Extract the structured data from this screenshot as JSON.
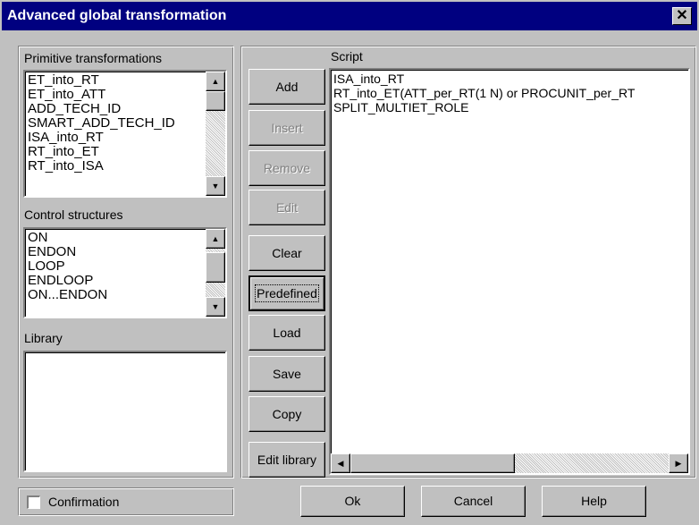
{
  "window": {
    "title": "Advanced global transformation",
    "close_glyph": "✕"
  },
  "left_panel": {
    "primitive": {
      "label": "Primitive transformations",
      "items": [
        "ET_into_RT",
        "ET_into_ATT",
        "ADD_TECH_ID",
        "SMART_ADD_TECH_ID",
        "ISA_into_RT",
        "RT_into_ET",
        "RT_into_ISA"
      ]
    },
    "control": {
      "label": "Control structures",
      "items": [
        "ON",
        "ENDON",
        "LOOP",
        "ENDLOOP",
        "ON...ENDON"
      ]
    },
    "library": {
      "label": "Library",
      "items": []
    }
  },
  "buttons": {
    "add": "Add",
    "insert": "Insert",
    "remove": "Remove",
    "edit": "Edit",
    "clear": "Clear",
    "predefined": "Predefined",
    "load": "Load",
    "save": "Save",
    "copy": "Copy",
    "edit_library": "Edit library"
  },
  "script": {
    "label": "Script",
    "lines": [
      "ISA_into_RT",
      "RT_into_ET(ATT_per_RT(1 N) or PROCUNIT_per_RT",
      "SPLIT_MULTIET_ROLE"
    ]
  },
  "footer": {
    "confirmation": "Confirmation",
    "ok": "Ok",
    "cancel": "Cancel",
    "help": "Help"
  },
  "icons": {
    "up": "▲",
    "down": "▼",
    "left": "◀",
    "right": "▶"
  },
  "colors": {
    "titlebar": "#000080",
    "face": "#c0c0c0",
    "disabled_text": "#808080"
  }
}
